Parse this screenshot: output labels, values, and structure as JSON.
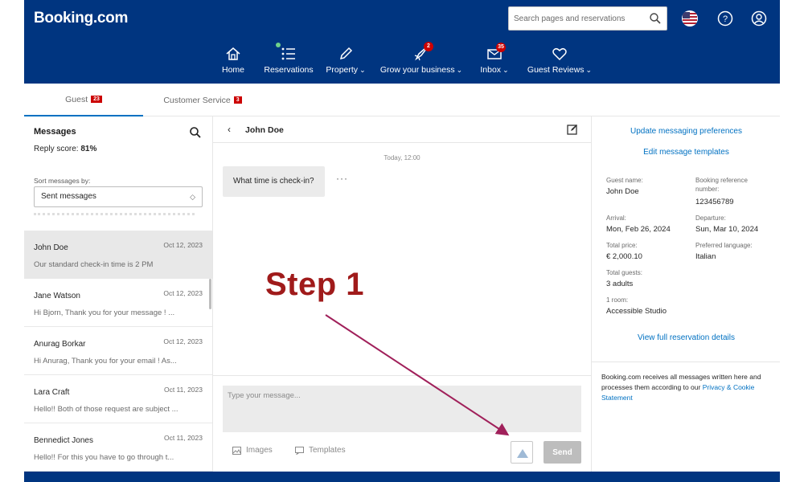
{
  "header": {
    "logo": "Booking.com",
    "search_placeholder": "Search pages and reservations",
    "nav": [
      {
        "label": "Home",
        "icon": "home-icon"
      },
      {
        "label": "Reservations",
        "icon": "list-icon"
      },
      {
        "label": "Property",
        "icon": "pencil-icon"
      },
      {
        "label": "Grow your business",
        "icon": "rocket-icon",
        "badge": "2"
      },
      {
        "label": "Inbox",
        "icon": "mail-icon",
        "badge": "35"
      },
      {
        "label": "Guest Reviews",
        "icon": "heart-icon"
      }
    ]
  },
  "tabs": [
    {
      "label": "Guest",
      "badge": "23"
    },
    {
      "label": "Customer Service",
      "badge": "3"
    }
  ],
  "messages_panel": {
    "title": "Messages",
    "reply_label": "Reply score:",
    "reply_value": "81%",
    "sort_label": "Sort messages by:",
    "sort_value": "Sent messages",
    "conversations": [
      {
        "name": "John Doe",
        "date": "Oct 12, 2023",
        "preview": "Our standard check-in time is 2 PM"
      },
      {
        "name": "Jane Watson",
        "date": "Oct 12, 2023",
        "preview": "Hi Bjorn, Thank you for your message ! ..."
      },
      {
        "name": "Anurag Borkar",
        "date": "Oct 12, 2023",
        "preview": "Hi Anurag, Thank you for your email ! As..."
      },
      {
        "name": "Lara Craft",
        "date": "Oct 11, 2023",
        "preview": "Hello!! Both of those request are subject ..."
      },
      {
        "name": "Bennedict Jones",
        "date": "Oct 11, 2023",
        "preview": "Hello!! For this you have to go through t..."
      }
    ]
  },
  "chat": {
    "name": "John Doe",
    "timestamp": "Today, 12:00",
    "message": "What time is check-in?",
    "more": "···",
    "input_placeholder": "Type your message...",
    "images_label": "Images",
    "templates_label": "Templates",
    "send_label": "Send"
  },
  "details": {
    "link_prefs": "Update messaging preferences",
    "link_templates": "Edit message templates",
    "guest_name_label": "Guest name:",
    "guest_name": "John Doe",
    "booking_ref_label": "Booking reference number:",
    "booking_ref": "123456789",
    "arrival_label": "Arrival:",
    "arrival": "Mon, Feb 26, 2024",
    "departure_label": "Departure:",
    "departure": "Sun, Mar 10, 2024",
    "total_price_label": "Total price:",
    "total_price": "€ 2,000.10",
    "language_label": "Preferred language:",
    "language": "Italian",
    "guests_label": "Total guests:",
    "guests": "3 adults",
    "rooms_label": "1 room:",
    "room": "Accessible Studio",
    "link_full": "View full reservation details",
    "notice": "Booking.com receives all messages written here and processes them according to our",
    "notice_link": "Privacy & Cookie Statement"
  },
  "annotation": {
    "text": "Step 1",
    "color": "#a01b1b",
    "arrow_color": "#a0205a"
  },
  "colors": {
    "brand": "#003580",
    "link": "#0071c2",
    "badge": "#cc0000"
  }
}
